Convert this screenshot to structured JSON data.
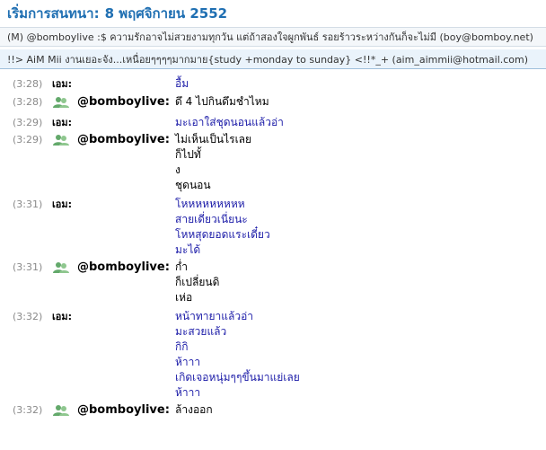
{
  "header": {
    "title": "เริ่มการสนทนา:",
    "date": "8 พฤศจิกายน 2552"
  },
  "participants": [
    "(M) @bomboylive :$ ความรักอาจไม่สวยงามทุกวัน แต่ถ้าสองใจผูกพันธ์ รอยร้าวระหว่างกันก็จะไม่มี (boy@bomboy.net)",
    "!!> AiM Mii งานเยอะจัง...เหนื่อยๆๆๆๆมากมาย{study +monday to sunday} <!!*_+ (aim_aimmii@hotmail.com)"
  ],
  "messages": [
    {
      "time": "(3:28)",
      "sender": "เอม:",
      "lines": [
        "อื้ม"
      ]
    },
    {
      "time": "(3:28)",
      "sender": "@bomboylive:",
      "lines": [
        "ดึ 4 ไปกินดึมชำไหม"
      ]
    },
    {
      "time": "(3:29)",
      "sender": "เอม:",
      "lines": [
        "มะเอาใส่ชุดนอนแล้วอ่า"
      ]
    },
    {
      "time": "(3:29)",
      "sender": "@bomboylive:",
      "lines": [
        "ไม่เห็นเป็นไรเลย",
        "ก็ไปทั้",
        "ง",
        "ชุดนอน"
      ]
    },
    {
      "time": "(3:31)",
      "sender": "เอม:",
      "lines": [
        "โหหหหหหหหห",
        "สายเดี่ยวเนี่ยนะ",
        "โหหสุดยอดแระเดี๋ยว",
        "มะได้"
      ]
    },
    {
      "time": "(3:31)",
      "sender": "@bomboylive:",
      "lines": [
        "ก่ำ",
        "ก็เปลี่ยนดิ",
        "เห่อ"
      ]
    },
    {
      "time": "(3:32)",
      "sender": "เอม:",
      "lines": [
        "หน้าทายาแล้วอ่า",
        "มะสวยแล้ว",
        "กิกิ",
        "ห้าาา",
        "เกิดเจอหนุ่มๆๆขึ้นมาแย่เลย",
        "ห้าาา"
      ]
    },
    {
      "time": "(3:32)",
      "sender": "@bomboylive:",
      "lines": [
        "ล้างออก"
      ]
    }
  ]
}
